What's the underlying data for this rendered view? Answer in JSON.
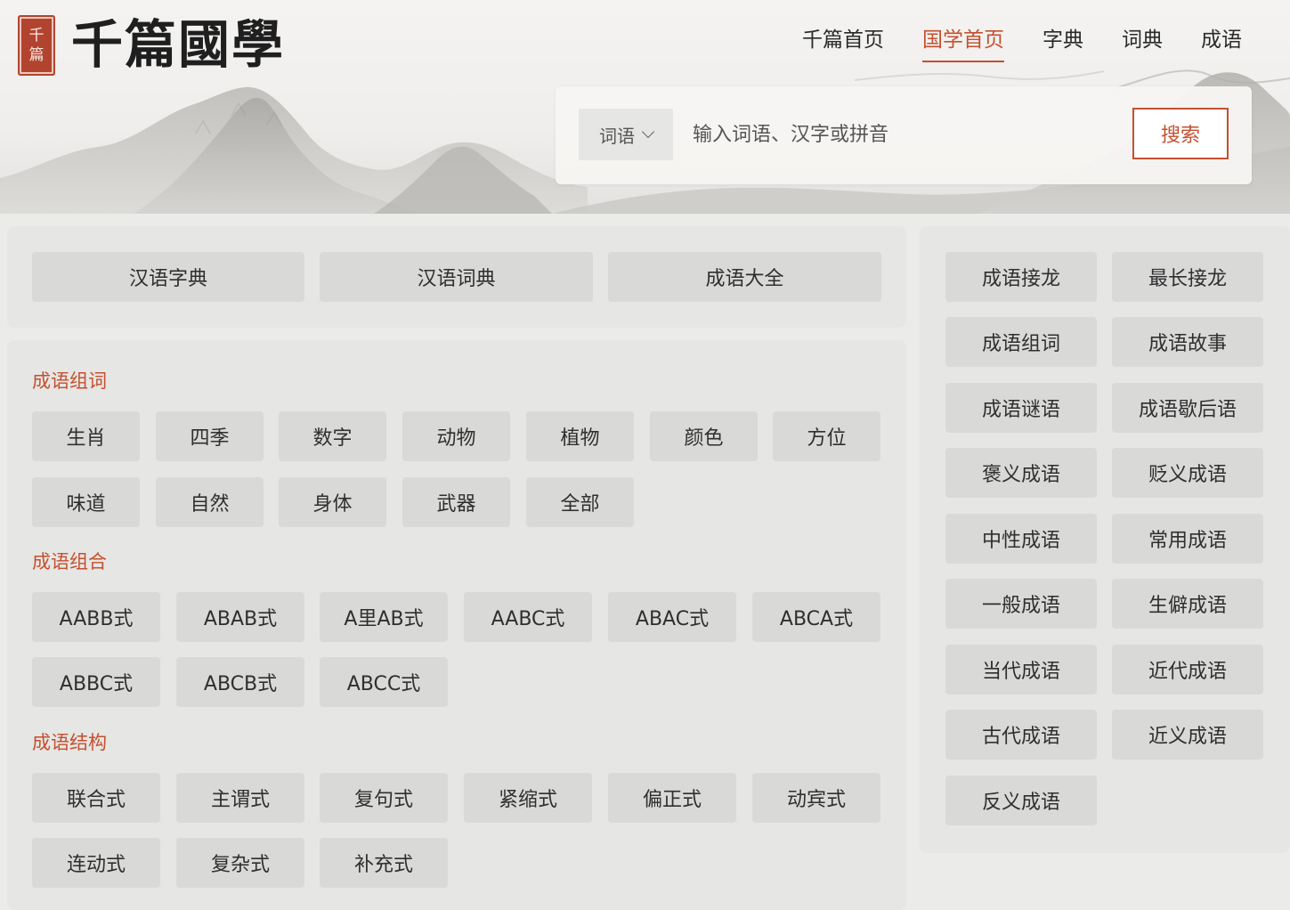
{
  "brand": {
    "seal_chars": [
      "千",
      "篇"
    ],
    "name": "千篇國學"
  },
  "nav": {
    "items": [
      "千篇首页",
      "国学首页",
      "字典",
      "词典",
      "成语"
    ],
    "active": "国学首页"
  },
  "search": {
    "select_value": "词语",
    "placeholder": "输入词语、汉字或拼音",
    "button_label": "搜索"
  },
  "quick_links": [
    "汉语字典",
    "汉语词典",
    "成语大全"
  ],
  "sections": [
    {
      "title": "成语组词",
      "items": [
        "生肖",
        "四季",
        "数字",
        "动物",
        "植物",
        "颜色",
        "方位",
        "味道",
        "自然",
        "身体",
        "武器",
        "全部"
      ]
    },
    {
      "title": "成语组合",
      "items": [
        "AABB式",
        "ABAB式",
        "A里AB式",
        "AABC式",
        "ABAC式",
        "ABCA式",
        "ABBC式",
        "ABCB式",
        "ABCC式"
      ]
    },
    {
      "title": "成语结构",
      "items": [
        "联合式",
        "主谓式",
        "复句式",
        "紧缩式",
        "偏正式",
        "动宾式",
        "连动式",
        "复杂式",
        "补充式"
      ]
    }
  ],
  "side_links": [
    "成语接龙",
    "最长接龙",
    "成语组词",
    "成语故事",
    "成语谜语",
    "成语歇后语",
    "褒义成语",
    "贬义成语",
    "中性成语",
    "常用成语",
    "一般成语",
    "生僻成语",
    "当代成语",
    "近代成语",
    "古代成语",
    "近义成语",
    "反义成语"
  ],
  "colors": {
    "accent": "#c4502f",
    "panel": "#e6e6e4",
    "button": "#d9d9d8",
    "seal": "#b2442f"
  }
}
